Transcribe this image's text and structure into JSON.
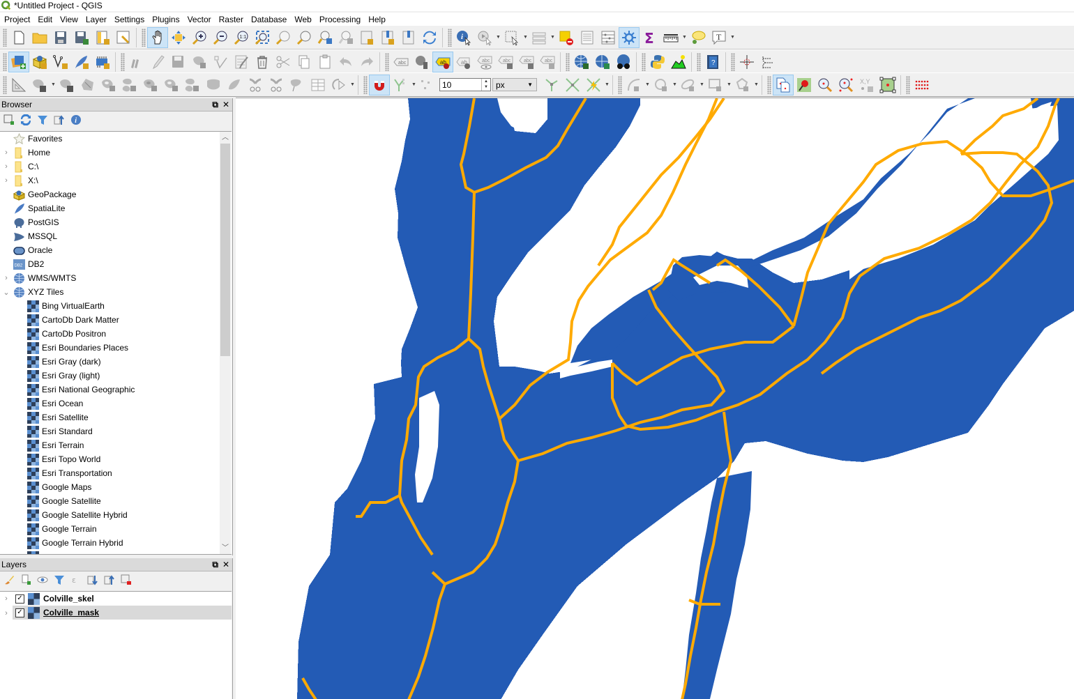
{
  "window": {
    "title": "*Untitled Project - QGIS"
  },
  "menubar": [
    "Project",
    "Edit",
    "View",
    "Layer",
    "Settings",
    "Plugins",
    "Vector",
    "Raster",
    "Database",
    "Web",
    "Processing",
    "Help"
  ],
  "toolbar": {
    "snapping_tolerance": "10",
    "snapping_units": "px"
  },
  "browser": {
    "title": "Browser",
    "items": [
      {
        "label": "Favorites",
        "icon": "star-icon",
        "expander": ""
      },
      {
        "label": "Home",
        "icon": "folder-icon",
        "expander": ">"
      },
      {
        "label": "C:\\",
        "icon": "folder-icon",
        "expander": ">"
      },
      {
        "label": "X:\\",
        "icon": "folder-icon",
        "expander": ">"
      },
      {
        "label": "GeoPackage",
        "icon": "geopackage-icon",
        "expander": ""
      },
      {
        "label": "SpatiaLite",
        "icon": "spatialite-icon",
        "expander": ""
      },
      {
        "label": "PostGIS",
        "icon": "postgis-icon",
        "expander": ""
      },
      {
        "label": "MSSQL",
        "icon": "mssql-icon",
        "expander": ""
      },
      {
        "label": "Oracle",
        "icon": "oracle-icon",
        "expander": ""
      },
      {
        "label": "DB2",
        "icon": "db2-icon",
        "expander": ""
      },
      {
        "label": "WMS/WMTS",
        "icon": "globe-icon",
        "expander": ">"
      },
      {
        "label": "XYZ Tiles",
        "icon": "globe-icon",
        "expander": "v"
      }
    ],
    "xyz_tiles": [
      "Bing VirtualEarth",
      "CartoDb Dark Matter",
      "CartoDb Positron",
      "Esri Boundaries Places",
      "Esri Gray (dark)",
      "Esri Gray (light)",
      "Esri National Geographic",
      "Esri Ocean",
      "Esri Satellite",
      "Esri Standard",
      "Esri Terrain",
      "Esri Topo World",
      "Esri Transportation",
      "Google Maps",
      "Google Satellite",
      "Google Satellite Hybrid",
      "Google Terrain",
      "Google Terrain Hybrid"
    ]
  },
  "layers": {
    "title": "Layers",
    "items": [
      {
        "name": "Colville_skel",
        "checked": true,
        "selected": false
      },
      {
        "name": "Colville_mask",
        "checked": true,
        "selected": true
      }
    ]
  },
  "map": {
    "mask_color": "#235bb5",
    "skeleton_color": "#ffaa00",
    "background": "#ffffff"
  }
}
